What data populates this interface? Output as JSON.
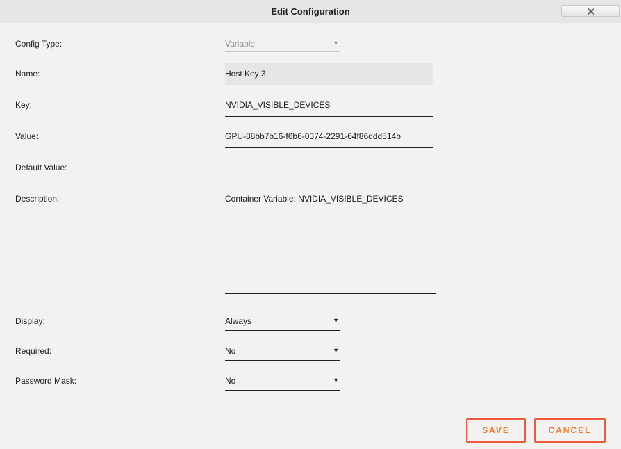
{
  "window": {
    "title": "Edit Configuration"
  },
  "form": {
    "config_type": {
      "label": "Config Type:",
      "value": "Variable"
    },
    "name": {
      "label": "Name:",
      "value": "Host Key 3"
    },
    "key": {
      "label": "Key:",
      "value": "NVIDIA_VISIBLE_DEVICES"
    },
    "value": {
      "label": "Value:",
      "value": "GPU-88bb7b16-f6b6-0374-2291-64f86ddd514b"
    },
    "default_value": {
      "label": "Default Value:",
      "value": ""
    },
    "description": {
      "label": "Description:",
      "value": "Container Variable: NVIDIA_VISIBLE_DEVICES"
    },
    "display": {
      "label": "Display:",
      "value": "Always"
    },
    "required": {
      "label": "Required:",
      "value": "No"
    },
    "password_mask": {
      "label": "Password Mask:",
      "value": "No"
    }
  },
  "buttons": {
    "save": "SAVE",
    "cancel": "CANCEL"
  },
  "colors": {
    "accent_border": "#ee5a3c",
    "accent_text": "#f07a2a"
  },
  "icons": {
    "close": "close-icon",
    "dropdown": "dropdown-arrow-icon"
  }
}
